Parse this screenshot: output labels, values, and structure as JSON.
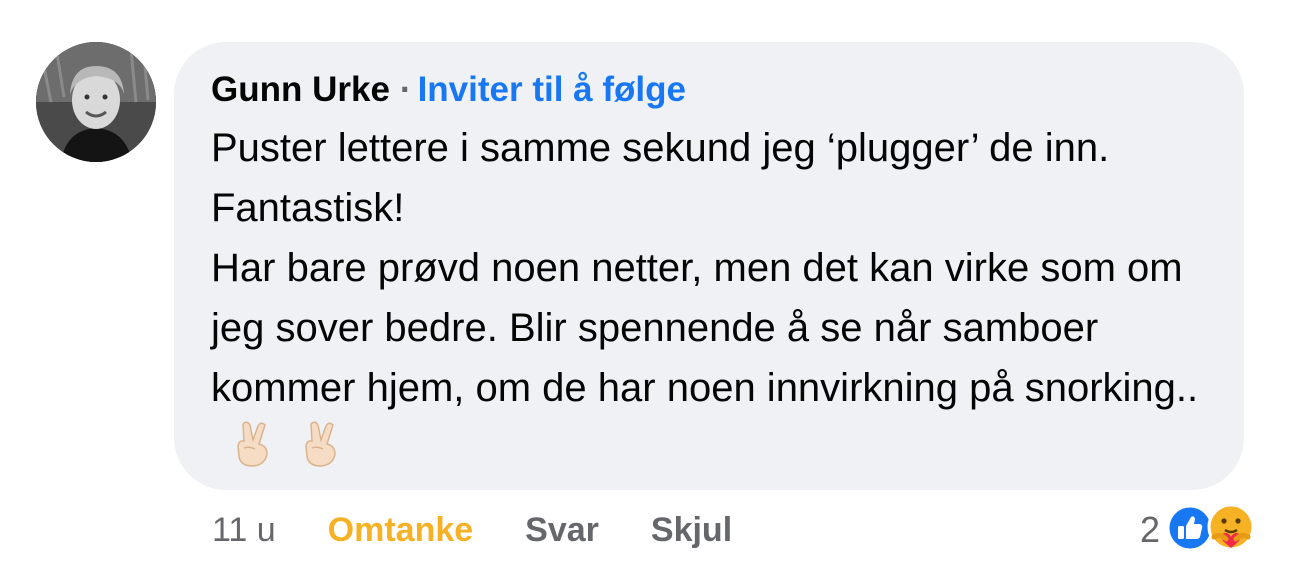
{
  "comment": {
    "author": "Gunn Urke",
    "separator": "·",
    "follow_label": "Inviter til å følge",
    "paragraphs": [
      "Puster lettere i samme sekund jeg ‘plugger’ de inn. Fantastisk!",
      "Har bare prøvd noen netter, men det kan virke som om jeg sover bedre. Blir spennende å se når samboer kommer hjem, om de har noen innvirkning på snorking.."
    ],
    "emojis": [
      "crossed-fingers-icon",
      "crossed-fingers-icon"
    ]
  },
  "actions": {
    "time": "11 u",
    "care_label": "Omtanke",
    "reply_label": "Svar",
    "hide_label": "Skjul"
  },
  "reactions": {
    "count": "2",
    "icons": [
      "like-icon",
      "care-icon"
    ]
  },
  "colors": {
    "bubble": "#f0f1f4",
    "link_blue": "#1877f2",
    "care_yellow": "#f7b125",
    "muted": "#65676b"
  }
}
